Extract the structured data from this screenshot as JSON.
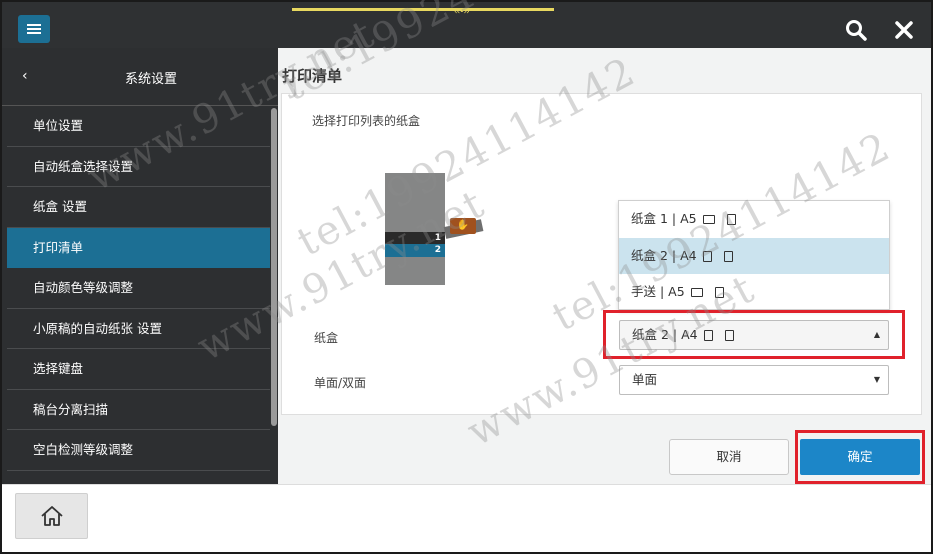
{
  "topbar": {
    "menu_icon": "hamburger-icon",
    "search_icon": "search-icon",
    "close_icon": "close-icon",
    "handle": "‹‹•››"
  },
  "sidebar": {
    "back_icon": "‹",
    "title": "系统设置",
    "items": [
      {
        "label": "单位设置"
      },
      {
        "label": "自动纸盒选择设置"
      },
      {
        "label": "纸盒 设置"
      },
      {
        "label": "打印清单"
      },
      {
        "label": "自动颜色等级调整"
      },
      {
        "label": "小原稿的自动纸张 设置"
      },
      {
        "label": "选择键盘"
      },
      {
        "label": "稿台分离扫描"
      },
      {
        "label": "空白检测等级调整"
      }
    ],
    "active_index": 3
  },
  "main": {
    "title": "打印清单",
    "section_label": "选择打印列表的纸盒",
    "tray_labels": {
      "tray1": "1",
      "tray2": "2"
    },
    "tray_field_label": "纸盒",
    "duplex_field_label": "单面/双面",
    "tray_dropdown": {
      "options": [
        {
          "label": "纸盒 1 | A5",
          "orientation": "landscape"
        },
        {
          "label": "纸盒 2 | A4",
          "orientation": "portrait"
        },
        {
          "label": "手送 | A5",
          "orientation": "landscape"
        }
      ],
      "highlighted_index": 1,
      "selected_value": "纸盒 2 | A4"
    },
    "duplex_select": {
      "value": "单面"
    },
    "cancel_label": "取消",
    "ok_label": "确定"
  },
  "bottombar": {
    "home_icon": "home-icon"
  },
  "colors": {
    "accent": "#1c6f94",
    "ok_button": "#1c86c8",
    "highlight": "#e0212b",
    "selected_option": "#cbe3ee"
  },
  "watermarks": [
    "tel:19924114142",
    "www.91try.net"
  ]
}
